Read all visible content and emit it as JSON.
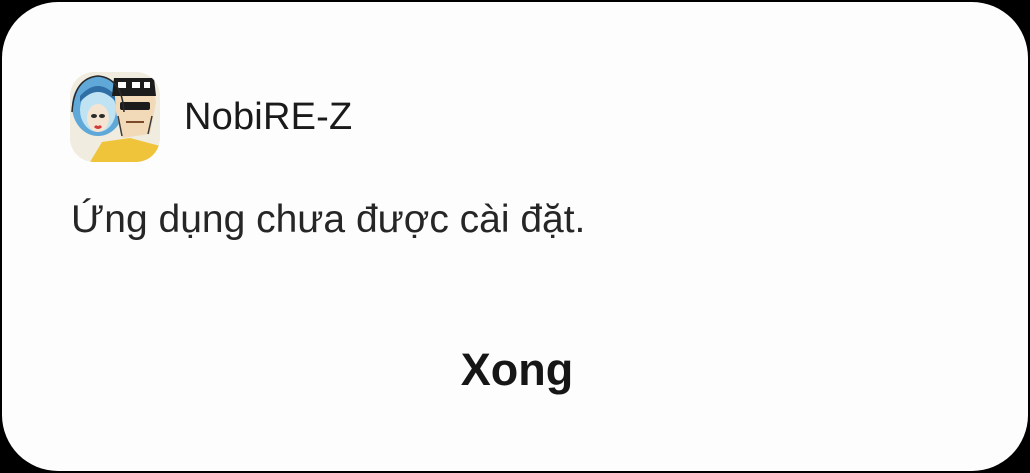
{
  "dialog": {
    "app_name": "NobiRE-Z",
    "app_icon": "nobire-z-app-icon",
    "message": "Ứng dụng chưa được cài đặt.",
    "done_label": "Xong"
  }
}
